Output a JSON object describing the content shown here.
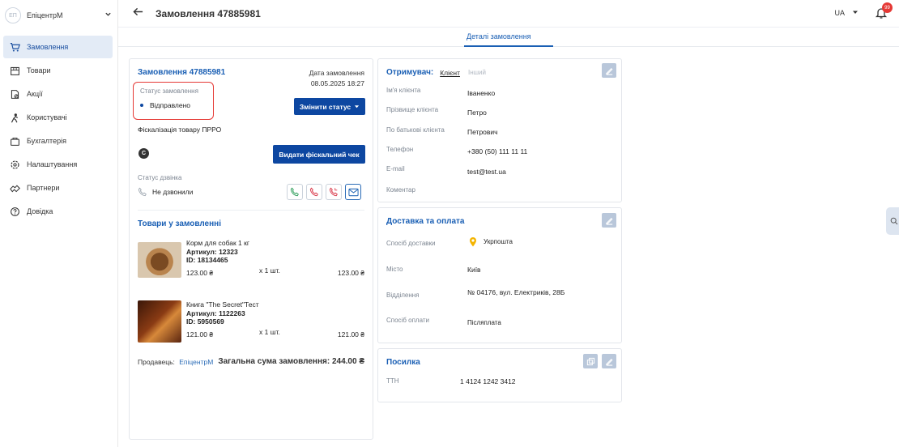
{
  "sidebar": {
    "org_logo": "ЕП",
    "org_name": "ЕпіцентрМ",
    "items": [
      {
        "label": "Замовлення",
        "icon": "cart-icon"
      },
      {
        "label": "Товари",
        "icon": "store-icon"
      },
      {
        "label": "Акції",
        "icon": "discount-icon"
      },
      {
        "label": "Користувачі",
        "icon": "users-icon"
      },
      {
        "label": "Бухгалтерія",
        "icon": "wallet-icon"
      },
      {
        "label": "Налаштування",
        "icon": "settings-icon"
      },
      {
        "label": "Партнери",
        "icon": "handshake-icon"
      },
      {
        "label": "Довідка",
        "icon": "help-icon"
      }
    ]
  },
  "header": {
    "title": "Замовлення 47885981",
    "language": "UA",
    "notification_count": "99"
  },
  "tabs": {
    "details": "Деталі замовлення"
  },
  "order": {
    "title": "Замовлення 47885981",
    "date_label": "Дата замовлення",
    "date_value": "08.05.2025 18:27",
    "status_label": "Статус замовлення",
    "status_value": "Відправлено",
    "change_status": "Змінити статус",
    "fiscal_label": "Фіскалізація товару ПРРО",
    "fiscal_badge": "C",
    "fiscal_button": "Видати фіскальний чек",
    "call_status_label": "Статус дзвінка",
    "call_status_value": "Не дзвонили",
    "products_title": "Товари у замовленні",
    "products": [
      {
        "name": "Корм для собак 1 кг",
        "sku": "Артикул: 12323",
        "id": "ID: 18134465",
        "price": "123.00 ₴",
        "qty": "x 1 шт.",
        "total": "123.00 ₴"
      },
      {
        "name": "Книга \"The Secret\"Тест",
        "sku": "Артикул: 1122263",
        "id": "ID: 5950569",
        "price": "121.00 ₴",
        "qty": "x 1 шт.",
        "total": "121.00 ₴"
      }
    ],
    "seller_label": "Продавець:",
    "seller_value": "ЕпіцентрМ",
    "total_label": "Загальна сума замовлення: 244.00 ₴"
  },
  "recipient": {
    "title": "Отримувач:",
    "tab_client": "Клієнт",
    "tab_other": "Інший",
    "fields": [
      {
        "label": "Ім'я клієнта",
        "value": "Іваненко"
      },
      {
        "label": "Прізвище клієнта",
        "value": "Петро"
      },
      {
        "label": "По батькові клієнта",
        "value": "Петрович"
      },
      {
        "label": "Телефон",
        "value": "+380 (50) 111 11 11"
      },
      {
        "label": "E-mail",
        "value": "test@test.ua"
      },
      {
        "label": "Коментар",
        "value": ""
      }
    ]
  },
  "delivery": {
    "title": "Доставка та оплата",
    "fields": [
      {
        "label": "Спосіб доставки",
        "value": "Укрпошта"
      },
      {
        "label": "Місто",
        "value": "Київ"
      },
      {
        "label": "Відділення",
        "value": "№ 04176, вул. Електриків, 28Б"
      },
      {
        "label": "Спосіб оплати",
        "value": "Післяплата"
      }
    ]
  },
  "parcel": {
    "title": "Посилка",
    "ttn_label": "ТТН",
    "ttn_value": "1 4124 1242 3412"
  },
  "colors": {
    "accent": "#0d47a1",
    "link": "#2b6cb7",
    "status_highlight": "#e53935"
  }
}
